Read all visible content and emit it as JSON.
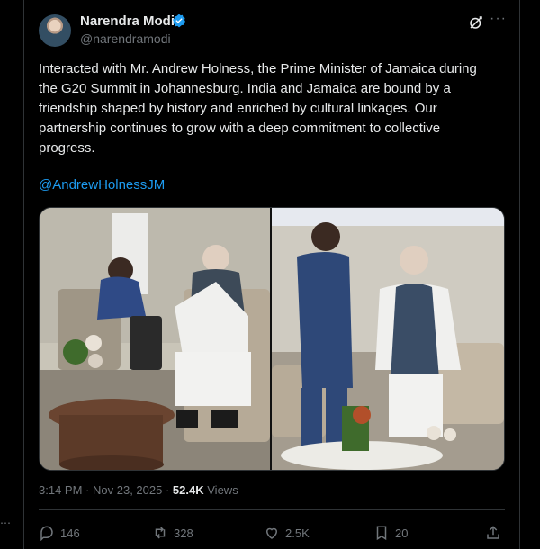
{
  "author": {
    "name": "Narendra Modi",
    "handle": "@narendramodi"
  },
  "post": {
    "text": "Interacted with Mr. Andrew Holness, the Prime Minister of Jamaica during the G20 Summit in Johannesburg. India and Jamaica are bound by a friendship shaped by history and enriched by cultural linkages. Our partnership continues to grow with a deep commitment to collective progress.",
    "mention": "@AndrewHolnessJM",
    "time": "3:14 PM",
    "date": "Nov 23, 2025",
    "views_count": "52.4K",
    "views_label": "Views"
  },
  "actions": {
    "replies": "146",
    "reposts": "328",
    "likes": "2.5K",
    "bookmarks": "20"
  },
  "icons": [
    "verified-icon",
    "grok-icon",
    "more-icon",
    "reply-icon",
    "repost-icon",
    "like-icon",
    "bookmark-icon",
    "share-icon"
  ],
  "colors": {
    "background": "#000000",
    "text": "#e7e9ea",
    "secondary": "#71767b",
    "link": "#1d9bf0",
    "verified": "#1d9bf0",
    "border": "#2f3336"
  }
}
